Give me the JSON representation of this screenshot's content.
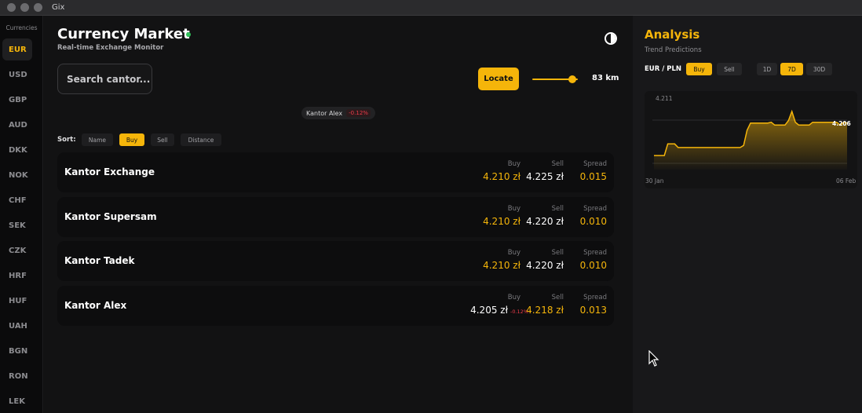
{
  "window": {
    "title": "Gix"
  },
  "sidebar": {
    "heading": "Currencies",
    "items": [
      "EUR",
      "USD",
      "GBP",
      "AUD",
      "DKK",
      "NOK",
      "CHF",
      "SEK",
      "CZK",
      "HRF",
      "HUF",
      "UAH",
      "BGN",
      "RON",
      "LEK"
    ],
    "active": "EUR"
  },
  "header": {
    "title": "Currency Market",
    "subtitle": "Real-time Exchange Monitor",
    "status_color": "#30c15a",
    "theme_icon": "contrast-icon"
  },
  "search": {
    "placeholder": "Search cantor..."
  },
  "locate": {
    "label": "Locate",
    "distance_label": "83 km",
    "slider_fraction": 0.88
  },
  "chip": {
    "name": "Kantor Alex",
    "change": "-0.12%"
  },
  "sort": {
    "label": "Sort:",
    "options": [
      "Name",
      "Buy",
      "Sell",
      "Distance"
    ],
    "active": "Buy"
  },
  "columns": {
    "buy": "Buy",
    "sell": "Sell",
    "spread": "Spread"
  },
  "rows": [
    {
      "name": "Kantor Exchange",
      "buy": "4.210 zł",
      "sell": "4.225 zł",
      "spread": "0.015",
      "buy_change": "",
      "highlight": "buy"
    },
    {
      "name": "Kantor Supersam",
      "buy": "4.210 zł",
      "sell": "4.220 zł",
      "spread": "0.010",
      "buy_change": "",
      "highlight": "buy"
    },
    {
      "name": "Kantor Tadek",
      "buy": "4.210 zł",
      "sell": "4.220 zł",
      "spread": "0.010",
      "buy_change": "",
      "highlight": "buy"
    },
    {
      "name": "Kantor Alex",
      "buy": "4.205 zł",
      "sell": "4.218 zł",
      "spread": "0.013",
      "buy_change": "-0.12%",
      "highlight": "sell"
    }
  ],
  "analysis": {
    "title": "Analysis",
    "subtitle": "Trend Predictions",
    "pair": "EUR / PLN",
    "mode_buttons": [
      "Buy",
      "Sell"
    ],
    "active_mode": "Buy",
    "range_buttons": [
      "1D",
      "7D",
      "30D"
    ],
    "active_range": "7D"
  },
  "chart_data": {
    "type": "area",
    "y_top_label": "4.211",
    "last_label": "4.206",
    "x_start_label": "30 Jan",
    "x_end_label": "06 Feb",
    "ylim": [
      4.195,
      4.213
    ],
    "values": [
      4.1985,
      4.1985,
      4.1985,
      4.1985,
      4.2014,
      4.2014,
      4.2014,
      4.2005,
      4.2005,
      4.2005,
      4.2005,
      4.2005,
      4.2005,
      4.2005,
      4.2005,
      4.2005,
      4.2005,
      4.2005,
      4.2005,
      4.2005,
      4.2005,
      4.2005,
      4.2005,
      4.2005,
      4.2005,
      4.2005,
      4.201,
      4.2048,
      4.2066,
      4.2066,
      4.2066,
      4.2066,
      4.2066,
      4.2066,
      4.2068,
      4.2061,
      4.2061,
      4.2061,
      4.2061,
      4.2072,
      4.2095,
      4.2068,
      4.2061,
      4.2061,
      4.2061,
      4.2061,
      4.2068,
      4.2068,
      4.2068,
      4.2068,
      4.2068,
      4.2068,
      4.2068,
      4.2068,
      4.2061,
      4.2068,
      4.2066
    ],
    "accent": "#f5b50a"
  }
}
